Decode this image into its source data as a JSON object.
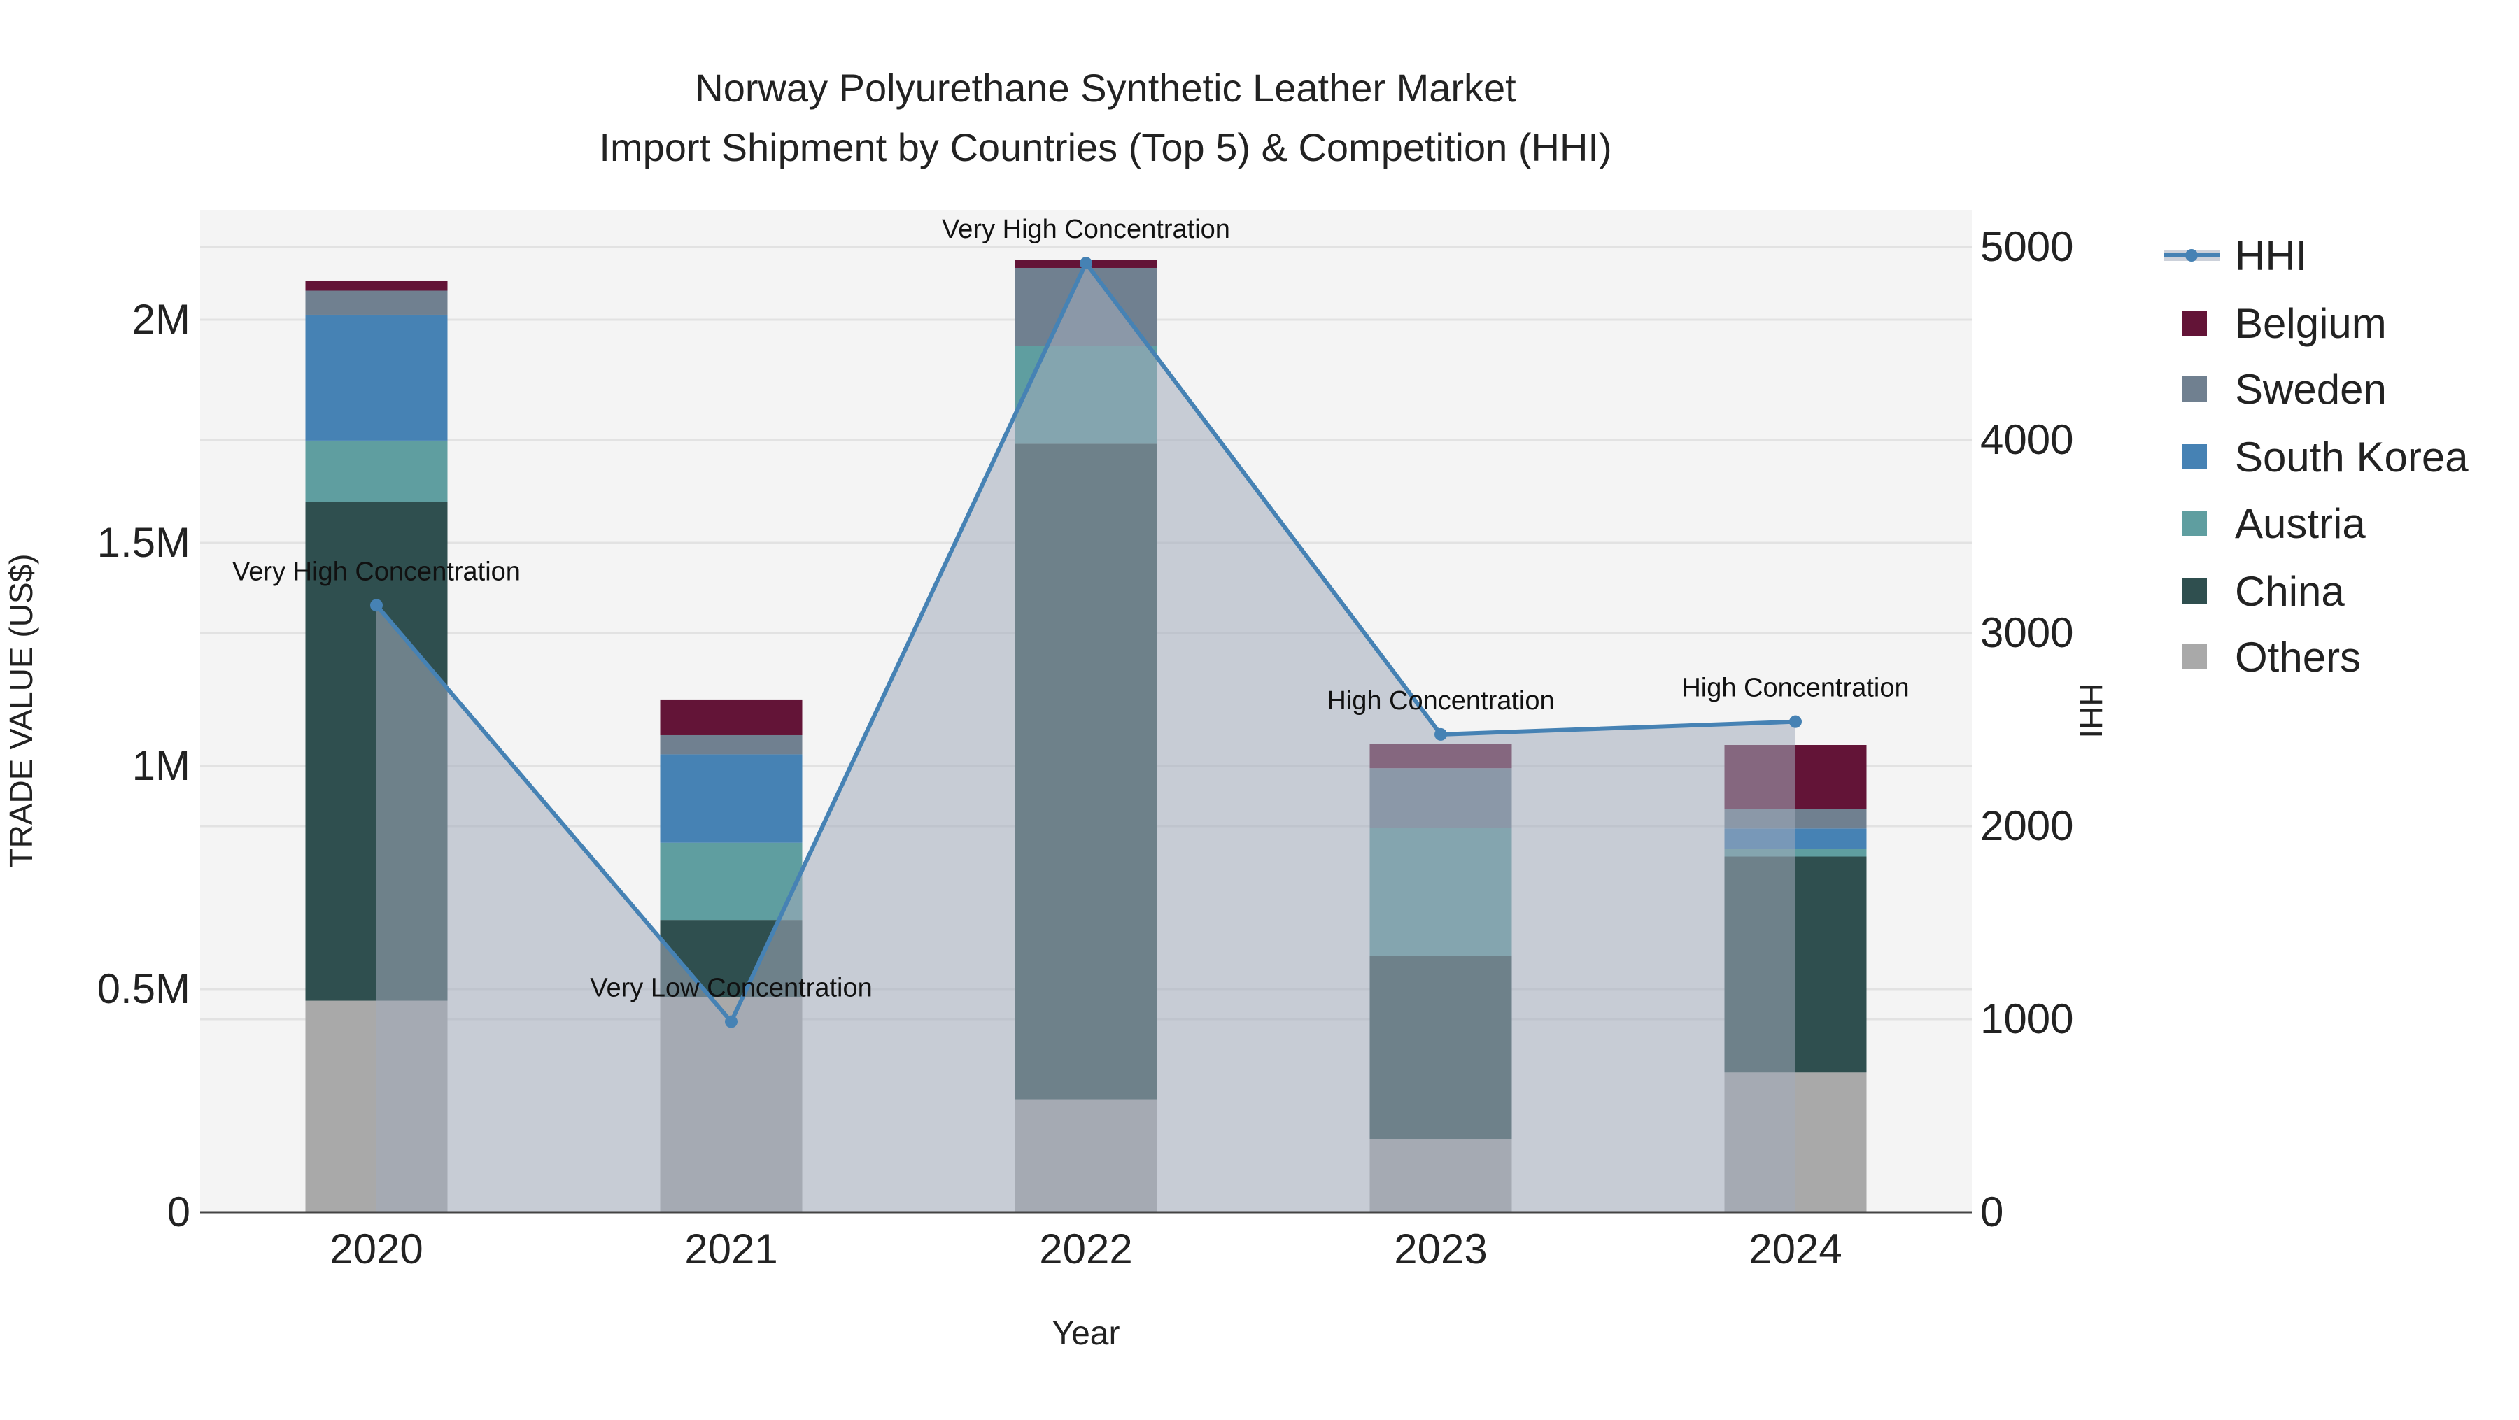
{
  "chart_data": {
    "type": "bar",
    "stacked": true,
    "title_line1": "Norway Polyurethane Synthetic Leather Market",
    "title_line2": "Import Shipment by Countries (Top 5) & Competition (HHI)",
    "xlabel": "Year",
    "ylabel": "TRADE VALUE (US$)",
    "y2label": "HHI",
    "categories": [
      "2020",
      "2021",
      "2022",
      "2023",
      "2024"
    ],
    "ylim": [
      0,
      2200000
    ],
    "y_ticks": [
      0,
      500000,
      1000000,
      1500000,
      2000000
    ],
    "y_tick_labels": [
      "0",
      "0.5M",
      "1M",
      "1.5M",
      "2M"
    ],
    "y2lim": [
      0,
      5200
    ],
    "y2_ticks": [
      0,
      1000,
      2000,
      3000,
      4000,
      5000
    ],
    "y2_tick_labels": [
      "0",
      "1000",
      "2000",
      "3000",
      "4000",
      "5000"
    ],
    "grid": true,
    "legend_position": "right",
    "series": [
      {
        "name": "Others",
        "color": "#a9a9a9",
        "values": [
          474000,
          482000,
          253000,
          163000,
          313000
        ]
      },
      {
        "name": "China",
        "color": "#2f4f4f",
        "values": [
          1117000,
          173000,
          1469000,
          412000,
          484000
        ]
      },
      {
        "name": "Austria",
        "color": "#5f9ea0",
        "values": [
          138000,
          173000,
          220000,
          286000,
          17000
        ]
      },
      {
        "name": "South Korea",
        "color": "#4682b4",
        "values": [
          282000,
          198000,
          0,
          0,
          46000
        ]
      },
      {
        "name": "Sweden",
        "color": "#708090",
        "values": [
          54000,
          43000,
          174000,
          134000,
          44000
        ]
      },
      {
        "name": "Belgium",
        "color": "#631437",
        "values": [
          22000,
          80000,
          18000,
          54000,
          143000
        ]
      }
    ],
    "hhi": {
      "name": "HHI",
      "color": "#4682b4",
      "values": [
        3144,
        987,
        4916,
        2475,
        2541
      ],
      "annotations": [
        "Very High Concentration",
        "Very Low Concentration",
        "Very High Concentration",
        "High Concentration",
        "High Concentration"
      ]
    },
    "legend": [
      "HHI",
      "Belgium",
      "Sweden",
      "South Korea",
      "Austria",
      "China",
      "Others"
    ]
  }
}
